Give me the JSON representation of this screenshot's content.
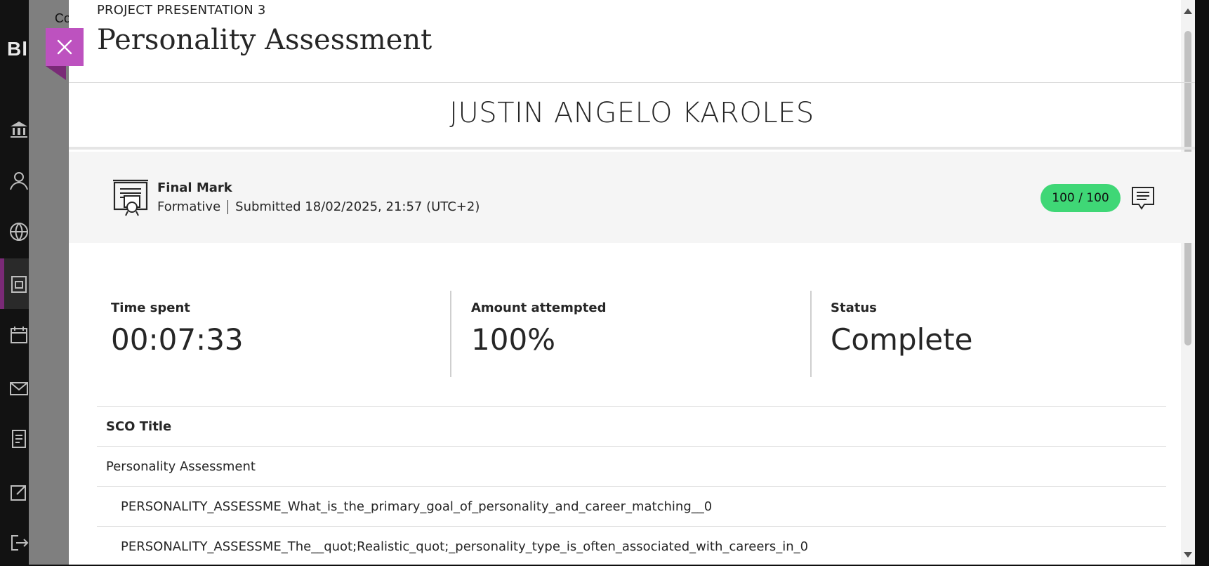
{
  "app": {
    "brand": "Bl",
    "breadcrumb": "Co",
    "nav_icons": [
      "institution-icon",
      "profile-icon",
      "globe-icon",
      "courses-icon",
      "calendar-icon",
      "messages-icon",
      "grades-icon",
      "tools-icon",
      "sign-out-icon"
    ]
  },
  "header": {
    "overline": "PROJECT PRESENTATION 3",
    "title": "Personality Assessment",
    "close_label": "Close"
  },
  "student": {
    "name": "JUSTIN ANGELO KAROLES"
  },
  "grade": {
    "label": "Final Mark",
    "type": "Formative",
    "submitted": "Submitted 18/02/2025, 21:57 (UTC+2)",
    "score": "100 / 100",
    "score_color": "#3fd776"
  },
  "stats": [
    {
      "label": "Time spent",
      "value": "00:07:33"
    },
    {
      "label": "Amount attempted",
      "value": "100%"
    },
    {
      "label": "Status",
      "value": "Complete"
    }
  ],
  "sco_table": {
    "header": "SCO Title",
    "rows": [
      "Personality Assessment",
      "PERSONALITY_ASSESSME_What_is_the_primary_goal_of_personality_and_career_matching__0",
      "PERSONALITY_ASSESSME_The__quot;Realistic_quot;_personality_type_is_often_associated_with_careers_in_0"
    ]
  },
  "colors": {
    "accent": "#bd52bf",
    "nav_active": "#7a2a77"
  }
}
